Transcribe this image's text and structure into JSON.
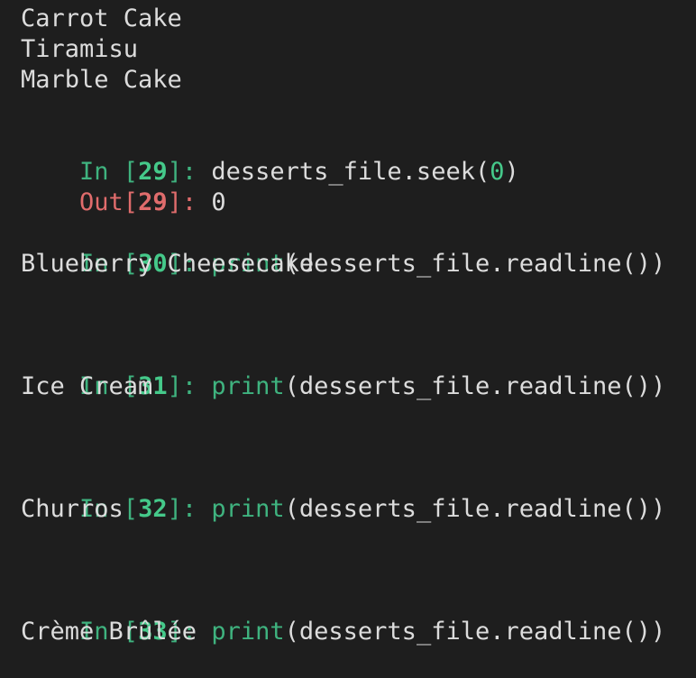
{
  "output_lines": [
    "Carrot Cake",
    "Tiramisu",
    "Marble Cake"
  ],
  "cells": [
    {
      "in_prefix": "In [",
      "number": "29",
      "in_suffix": "]: ",
      "code_before": "desserts_file.seek(",
      "code_arg": "0",
      "code_after": ")",
      "out_prefix": "Out[",
      "out_number": "29",
      "out_suffix": "]: ",
      "out_value": "0"
    },
    {
      "in_prefix": "In [",
      "number": "30",
      "in_suffix": "]: ",
      "code_func": "print",
      "code_rest": "(desserts_file.readline())",
      "output": "Blueberry Cheesecake"
    },
    {
      "in_prefix": "In [",
      "number": "31",
      "in_suffix": "]: ",
      "code_func": "print",
      "code_rest": "(desserts_file.readline())",
      "output": "Ice Cream"
    },
    {
      "in_prefix": "In [",
      "number": "32",
      "in_suffix": "]: ",
      "code_func": "print",
      "code_rest": "(desserts_file.readline())",
      "output": "Churros"
    },
    {
      "in_prefix": "In [",
      "number": "33",
      "in_suffix": "]: ",
      "code_func": "print",
      "code_rest": "(desserts_file.readline())",
      "output": "Crème Brûlée"
    }
  ],
  "colors": {
    "background": "#1e1e1e",
    "text": "#dcdcdc",
    "prompt_in": "#3fb37f",
    "prompt_out": "#e06c6c"
  }
}
